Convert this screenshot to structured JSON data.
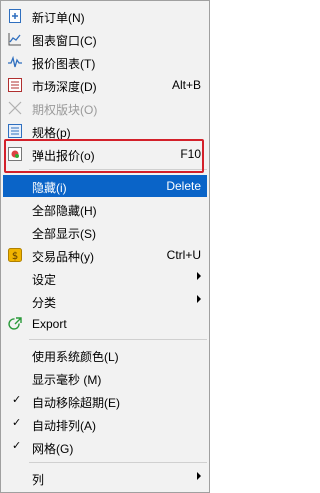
{
  "menu": {
    "items": [
      {
        "label": "新订单(N)",
        "shortcut": "",
        "icon": "new-order-icon"
      },
      {
        "label": "图表窗口(C)",
        "shortcut": "",
        "icon": "chart-window-icon"
      },
      {
        "label": "报价图表(T)",
        "shortcut": "",
        "icon": "quote-chart-icon"
      },
      {
        "label": "市场深度(D)",
        "shortcut": "Alt+B",
        "icon": "market-depth-icon"
      },
      {
        "label": "期权版块(O)",
        "shortcut": "",
        "icon": "options-board-icon",
        "disabled": true
      },
      {
        "label": "规格(p)",
        "shortcut": "",
        "icon": "specification-icon"
      },
      {
        "label": "弹出报价(o)",
        "shortcut": "F10",
        "icon": "popup-quote-icon"
      },
      {
        "label": "隐藏(i)",
        "shortcut": "Delete",
        "selected": true
      },
      {
        "label": "全部隐藏(H)",
        "shortcut": ""
      },
      {
        "label": "全部显示(S)",
        "shortcut": ""
      },
      {
        "label": "交易品种(y)",
        "shortcut": "Ctrl+U",
        "icon": "symbols-icon"
      },
      {
        "label": "设定",
        "shortcut": "",
        "submenu": true
      },
      {
        "label": "分类",
        "shortcut": "",
        "submenu": true
      },
      {
        "label": "Export",
        "shortcut": "",
        "icon": "export-icon"
      },
      {
        "label": "使用系统颜色(L)",
        "shortcut": ""
      },
      {
        "label": "显示毫秒 (M)",
        "shortcut": ""
      },
      {
        "label": "自动移除超期(E)",
        "shortcut": "",
        "checked": true
      },
      {
        "label": "自动排列(A)",
        "shortcut": "",
        "checked": true
      },
      {
        "label": "网格(G)",
        "shortcut": "",
        "checked": true
      },
      {
        "label": "列",
        "shortcut": "",
        "submenu": true
      }
    ],
    "check_mark": "✓"
  },
  "colors": {
    "selection": "#0a64c8",
    "highlight_box": "#d3202a",
    "disabled_text": "#9a9a9a"
  }
}
